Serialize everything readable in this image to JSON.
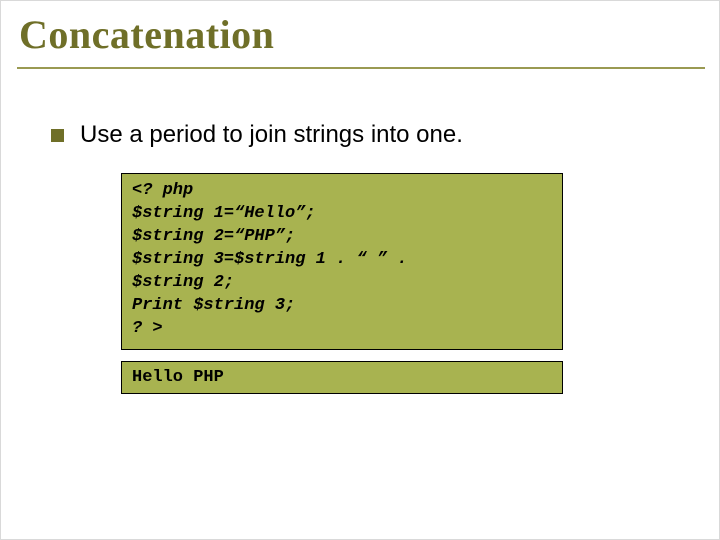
{
  "slide": {
    "title": "Concatenation",
    "bullet": "Use a period to join strings into one.",
    "code_lines": [
      "<? php",
      "$string 1=“Hello”;",
      "$string 2=“PHP”;",
      "$string 3=$string 1 . “ ” .",
      "$string 2;",
      "Print $string 3;",
      "? >"
    ],
    "output": "Hello PHP"
  }
}
